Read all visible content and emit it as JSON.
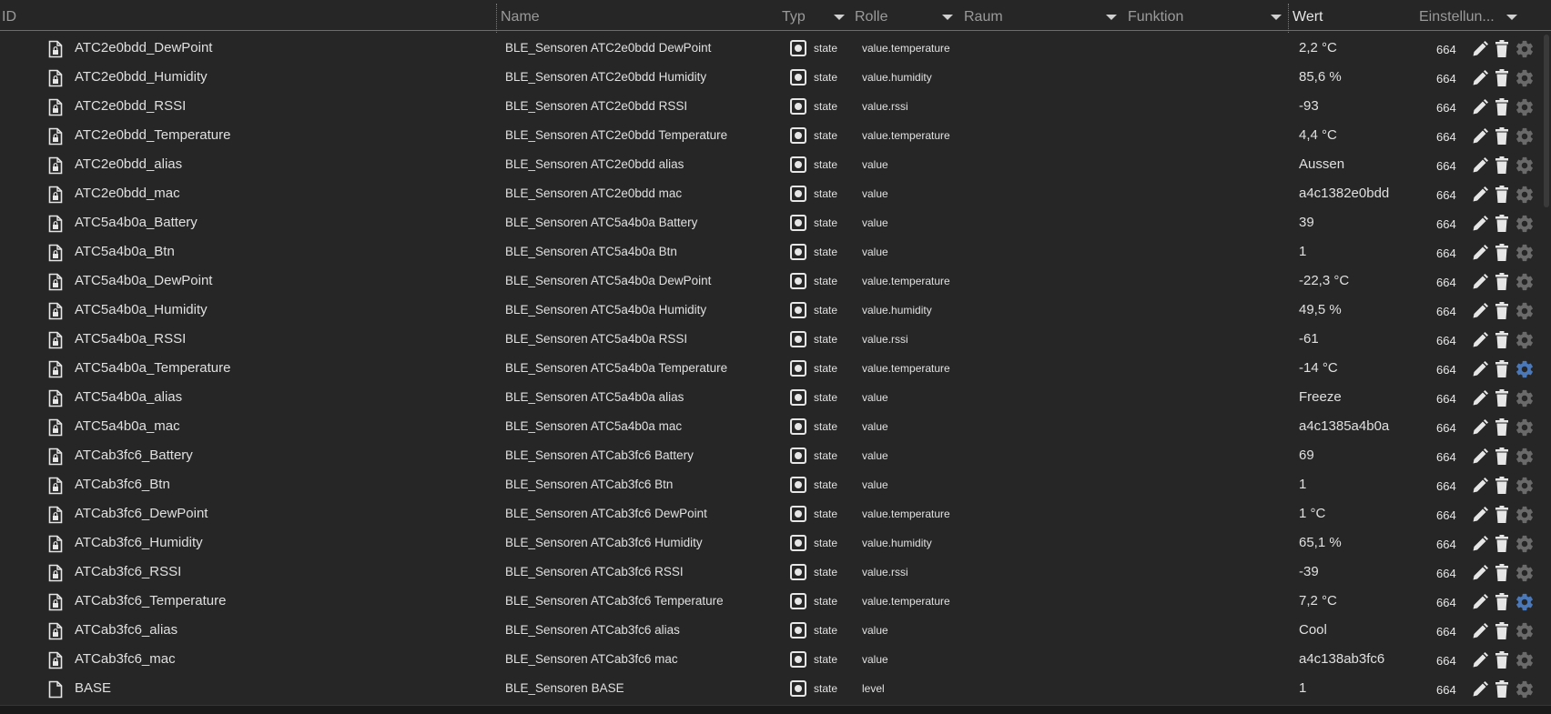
{
  "columns": {
    "id": "ID",
    "name": "Name",
    "type": "Typ",
    "role": "Rolle",
    "room": "Raum",
    "function": "Funktion",
    "value": "Wert",
    "settings": "Einstellun..."
  },
  "colors": {
    "background": "#262626",
    "text": "#e0e0e0",
    "header_text": "#9a9a9a",
    "gear_active": "#4a78b8",
    "gear_inactive": "#6a6a6a"
  },
  "rows": [
    {
      "id": "ATC2e0bdd_DewPoint",
      "name": "BLE_Sensoren ATC2e0bdd DewPoint",
      "type": "state",
      "role": "value.temperature",
      "value": "2,2 °C",
      "acl": "664",
      "icon": "file-lock-icon",
      "gear": "gear-icon"
    },
    {
      "id": "ATC2e0bdd_Humidity",
      "name": "BLE_Sensoren ATC2e0bdd Humidity",
      "type": "state",
      "role": "value.humidity",
      "value": "85,6 %",
      "acl": "664",
      "icon": "file-lock-icon",
      "gear": "gear-icon"
    },
    {
      "id": "ATC2e0bdd_RSSI",
      "name": "BLE_Sensoren ATC2e0bdd RSSI",
      "type": "state",
      "role": "value.rssi",
      "value": "-93",
      "acl": "664",
      "icon": "file-lock-icon",
      "gear": "gear-icon"
    },
    {
      "id": "ATC2e0bdd_Temperature",
      "name": "BLE_Sensoren ATC2e0bdd Temperature",
      "type": "state",
      "role": "value.temperature",
      "value": "4,4 °C",
      "acl": "664",
      "icon": "file-lock-icon",
      "gear": "gear-icon"
    },
    {
      "id": "ATC2e0bdd_alias",
      "name": "BLE_Sensoren ATC2e0bdd alias",
      "type": "state",
      "role": "value",
      "value": "Aussen",
      "acl": "664",
      "icon": "file-lock-icon",
      "gear": "gear-icon"
    },
    {
      "id": "ATC2e0bdd_mac",
      "name": "BLE_Sensoren ATC2e0bdd mac",
      "type": "state",
      "role": "value",
      "value": "a4c1382e0bdd",
      "acl": "664",
      "icon": "file-lock-icon",
      "gear": "gear-icon"
    },
    {
      "id": "ATC5a4b0a_Battery",
      "name": "BLE_Sensoren ATC5a4b0a Battery",
      "type": "state",
      "role": "value",
      "value": "39",
      "acl": "664",
      "icon": "file-lock-icon",
      "gear": "gear-icon"
    },
    {
      "id": "ATC5a4b0a_Btn",
      "name": "BLE_Sensoren ATC5a4b0a Btn",
      "type": "state",
      "role": "value",
      "value": "1",
      "acl": "664",
      "icon": "file-lock-icon",
      "gear": "gear-icon"
    },
    {
      "id": "ATC5a4b0a_DewPoint",
      "name": "BLE_Sensoren ATC5a4b0a DewPoint",
      "type": "state",
      "role": "value.temperature",
      "value": "-22,3 °C",
      "acl": "664",
      "icon": "file-lock-icon",
      "gear": "gear-icon"
    },
    {
      "id": "ATC5a4b0a_Humidity",
      "name": "BLE_Sensoren ATC5a4b0a Humidity",
      "type": "state",
      "role": "value.humidity",
      "value": "49,5 %",
      "acl": "664",
      "icon": "file-lock-icon",
      "gear": "gear-icon"
    },
    {
      "id": "ATC5a4b0a_RSSI",
      "name": "BLE_Sensoren ATC5a4b0a RSSI",
      "type": "state",
      "role": "value.rssi",
      "value": "-61",
      "acl": "664",
      "icon": "file-lock-icon",
      "gear": "gear-icon"
    },
    {
      "id": "ATC5a4b0a_Temperature",
      "name": "BLE_Sensoren ATC5a4b0a Temperature",
      "type": "state",
      "role": "value.temperature",
      "value": "-14 °C",
      "acl": "664",
      "icon": "file-lock-icon",
      "gear": "gear-active-icon"
    },
    {
      "id": "ATC5a4b0a_alias",
      "name": "BLE_Sensoren ATC5a4b0a alias",
      "type": "state",
      "role": "value",
      "value": "Freeze",
      "acl": "664",
      "icon": "file-lock-icon",
      "gear": "gear-icon"
    },
    {
      "id": "ATC5a4b0a_mac",
      "name": "BLE_Sensoren ATC5a4b0a mac",
      "type": "state",
      "role": "value",
      "value": "a4c1385a4b0a",
      "acl": "664",
      "icon": "file-lock-icon",
      "gear": "gear-icon"
    },
    {
      "id": "ATCab3fc6_Battery",
      "name": "BLE_Sensoren ATCab3fc6 Battery",
      "type": "state",
      "role": "value",
      "value": "69",
      "acl": "664",
      "icon": "file-lock-icon",
      "gear": "gear-icon"
    },
    {
      "id": "ATCab3fc6_Btn",
      "name": "BLE_Sensoren ATCab3fc6 Btn",
      "type": "state",
      "role": "value",
      "value": "1",
      "acl": "664",
      "icon": "file-lock-icon",
      "gear": "gear-icon"
    },
    {
      "id": "ATCab3fc6_DewPoint",
      "name": "BLE_Sensoren ATCab3fc6 DewPoint",
      "type": "state",
      "role": "value.temperature",
      "value": "1 °C",
      "acl": "664",
      "icon": "file-lock-icon",
      "gear": "gear-icon"
    },
    {
      "id": "ATCab3fc6_Humidity",
      "name": "BLE_Sensoren ATCab3fc6 Humidity",
      "type": "state",
      "role": "value.humidity",
      "value": "65,1 %",
      "acl": "664",
      "icon": "file-lock-icon",
      "gear": "gear-icon"
    },
    {
      "id": "ATCab3fc6_RSSI",
      "name": "BLE_Sensoren ATCab3fc6 RSSI",
      "type": "state",
      "role": "value.rssi",
      "value": "-39",
      "acl": "664",
      "icon": "file-lock-icon",
      "gear": "gear-icon"
    },
    {
      "id": "ATCab3fc6_Temperature",
      "name": "BLE_Sensoren ATCab3fc6 Temperature",
      "type": "state",
      "role": "value.temperature",
      "value": "7,2 °C",
      "acl": "664",
      "icon": "file-lock-icon",
      "gear": "gear-active-icon"
    },
    {
      "id": "ATCab3fc6_alias",
      "name": "BLE_Sensoren ATCab3fc6 alias",
      "type": "state",
      "role": "value",
      "value": "Cool",
      "acl": "664",
      "icon": "file-lock-icon",
      "gear": "gear-icon"
    },
    {
      "id": "ATCab3fc6_mac",
      "name": "BLE_Sensoren ATCab3fc6 mac",
      "type": "state",
      "role": "value",
      "value": "a4c138ab3fc6",
      "acl": "664",
      "icon": "file-lock-icon",
      "gear": "gear-icon"
    },
    {
      "id": "BASE",
      "name": "BLE_Sensoren BASE",
      "type": "state",
      "role": "level",
      "value": "1",
      "acl": "664",
      "icon": "file-icon",
      "gear": "gear-icon"
    }
  ]
}
